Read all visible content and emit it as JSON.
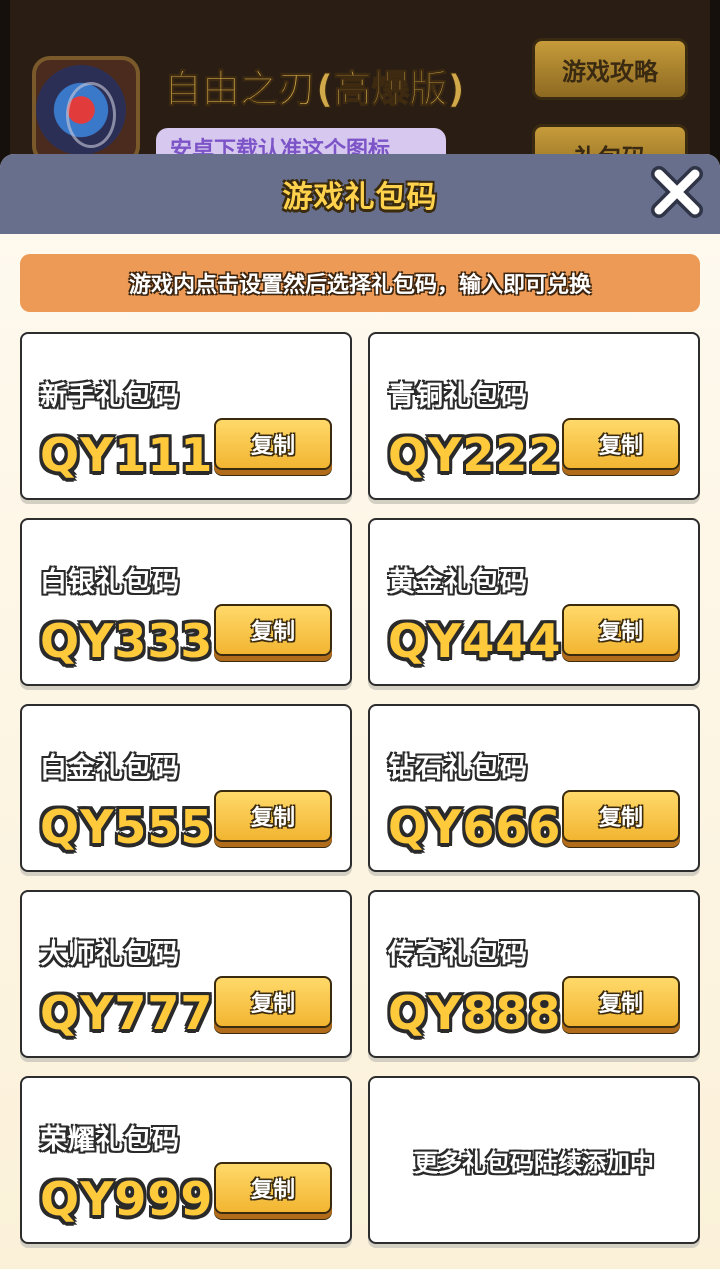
{
  "background": {
    "game_title": "自由之刃(高爆版)",
    "game_subtitle": "安卓下载认准这个图标",
    "button_strategy": "游戏攻略",
    "button_giftcode": "礼包码"
  },
  "dialog": {
    "title": "游戏礼包码",
    "close_icon": "close-x-icon",
    "notice": "游戏内点击设置然后选择礼包码，输入即可兑换",
    "copy_label": "复制",
    "cards": [
      {
        "label": "新手礼包码",
        "code": "QY111"
      },
      {
        "label": "青铜礼包码",
        "code": "QY222"
      },
      {
        "label": "白银礼包码",
        "code": "QY333"
      },
      {
        "label": "黄金礼包码",
        "code": "QY444"
      },
      {
        "label": "白金礼包码",
        "code": "QY555"
      },
      {
        "label": "钻石礼包码",
        "code": "QY666"
      },
      {
        "label": "大师礼包码",
        "code": "QY777"
      },
      {
        "label": "传奇礼包码",
        "code": "QY888"
      },
      {
        "label": "荣耀礼包码",
        "code": "QY999"
      }
    ],
    "more_text": "更多礼包码陆续添加中"
  },
  "colors": {
    "header_bg": "#676f8c",
    "title_yellow": "#ffd24d",
    "notice_orange": "#ec9a55",
    "code_yellow": "#ffc93c",
    "button_yellow": "#f2b531"
  }
}
